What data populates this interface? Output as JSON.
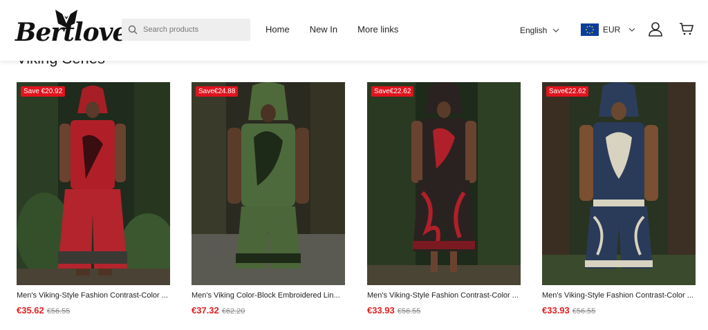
{
  "brand": {
    "name": "Bertlove"
  },
  "search": {
    "placeholder": "Search products"
  },
  "nav": [
    "Home",
    "New In",
    "More links"
  ],
  "language": {
    "label": "English"
  },
  "currency": {
    "label": "EUR"
  },
  "section": {
    "title": "Viking Series"
  },
  "products": [
    {
      "badge": "Save €20.92",
      "title": "Men's Viking-Style Fashion Contrast-Color ...",
      "price": "€35.62",
      "was": "€56.55"
    },
    {
      "badge": "Save€24.88",
      "title": "Men's Viking Color-Block Embroidered Lin...",
      "price": "€37.32",
      "was": "€62.20"
    },
    {
      "badge": "Save€22.62",
      "title": "Men's Viking-Style Fashion Contrast-Color ...",
      "price": "€33.93",
      "was": "€56.55"
    },
    {
      "badge": "Save€22.62",
      "title": "Men's Viking-Style Fashion Contrast-Color ...",
      "price": "€33.93",
      "was": "€56.55"
    }
  ],
  "colors": {
    "sale": "#e0141e",
    "price": "#e02020"
  }
}
